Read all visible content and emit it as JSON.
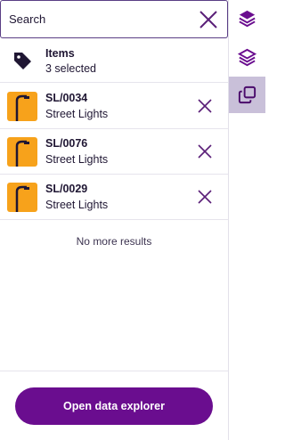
{
  "search": {
    "placeholder": "Search"
  },
  "summary": {
    "title": "Items",
    "count": "3 selected"
  },
  "results": [
    {
      "ref": "SL/0034",
      "type": "Street Lights"
    },
    {
      "ref": "SL/0076",
      "type": "Street Lights"
    },
    {
      "ref": "SL/0029",
      "type": "Street Lights"
    }
  ],
  "no_more": "No more results",
  "footer": {
    "open_label": "Open data explorer"
  },
  "icons": {
    "clear": "close-icon",
    "summary": "tag-icon",
    "thumb": "street-light-icon",
    "remove": "close-icon",
    "rail": [
      "layers-icon",
      "layers-icon",
      "copy-icon"
    ]
  },
  "colors": {
    "accent": "#6a0d8f",
    "thumb_bg": "#f7a21b",
    "rail_active": "#c9c0d9"
  }
}
